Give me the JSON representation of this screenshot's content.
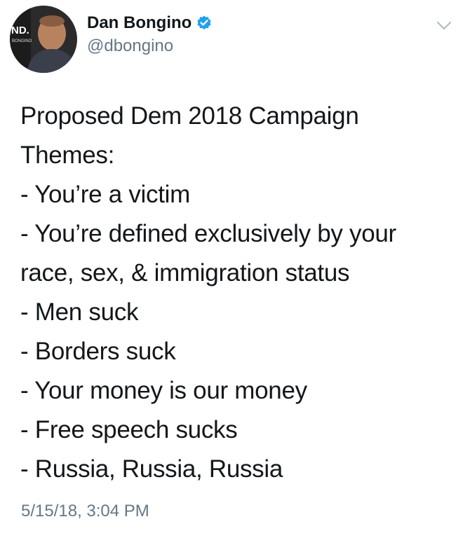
{
  "tweet": {
    "author": {
      "display_name": "Dan Bongino",
      "handle": "@dbongino",
      "verified": true,
      "avatar_text": "ND.",
      "avatar_subtext": "BONGINO"
    },
    "text_lines": [
      "Proposed Dem 2018 Campaign",
      "Themes:",
      "- You’re a victim",
      "- You’re defined exclusively by your",
      "race, sex, & immigration status",
      "- Men suck",
      "- Borders suck",
      "- Your money is our money",
      "- Free speech sucks",
      "- Russia, Russia, Russia"
    ],
    "timestamp": "5/15/18, 3:04 PM"
  },
  "icons": {
    "verified": "verified-badge-icon",
    "menu": "chevron-down-icon"
  },
  "colors": {
    "text": "#14171a",
    "secondary_text": "#657786",
    "verified_blue": "#1da1f2",
    "background": "#ffffff"
  }
}
